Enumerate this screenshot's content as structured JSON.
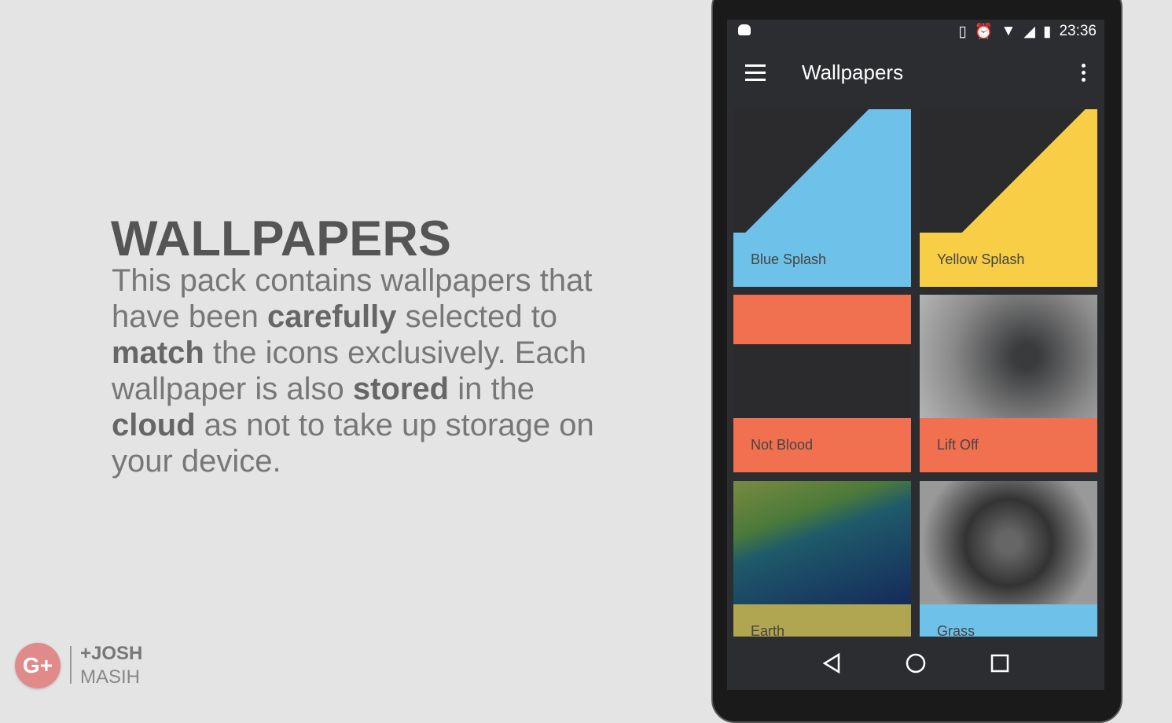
{
  "promo": {
    "title": "WALLPAPERS",
    "description": [
      {
        "t": "This pack contains wallpapers that have been ",
        "b": false
      },
      {
        "t": "carefully",
        "b": true
      },
      {
        "t": " selected to ",
        "b": false
      },
      {
        "t": "match",
        "b": true
      },
      {
        "t": " the icons exclusively. Each wallpaper is also ",
        "b": false
      },
      {
        "t": "stored",
        "b": true
      },
      {
        "t": " in the ",
        "b": false
      },
      {
        "t": "cloud",
        "b": true
      },
      {
        "t": " as not to take up storage on your device.",
        "b": false
      }
    ],
    "author_line1": "+JOSH",
    "author_line2": "MASIH",
    "gplus_label": "G+"
  },
  "status_bar": {
    "time": "23:36",
    "icons": [
      "android-icon",
      "vibrate-icon",
      "alarm-icon",
      "wifi-icon",
      "signal-icon",
      "battery-charging-icon"
    ]
  },
  "toolbar": {
    "title": "Wallpapers"
  },
  "wallpapers": [
    {
      "label": "Blue Splash",
      "color": "#6ec1e8"
    },
    {
      "label": "Yellow Splash",
      "color": "#f7ce45"
    },
    {
      "label": "Not Blood",
      "color": "#f07050"
    },
    {
      "label": "Lift Off",
      "color": "#f07050"
    },
    {
      "label": "Earth",
      "color": "#b0a550"
    },
    {
      "label": "Grass",
      "color": "#6ec1e8"
    }
  ]
}
